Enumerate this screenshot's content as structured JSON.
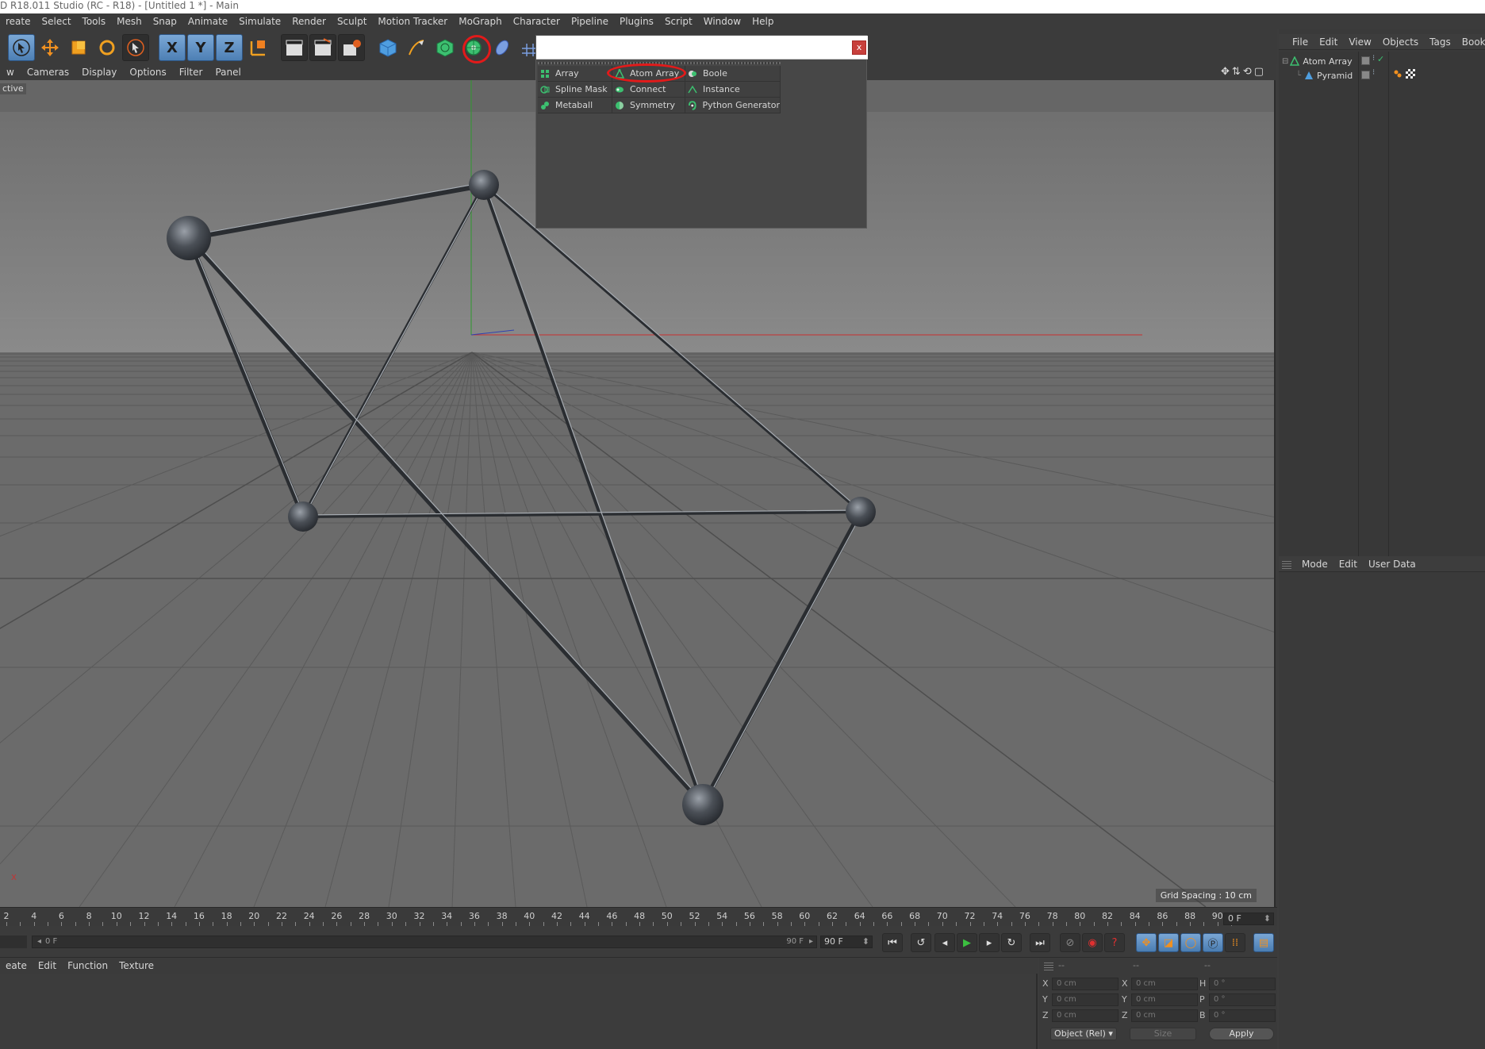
{
  "window": {
    "title": "D R18.011 Studio (RC - R18) - [Untitled 1 *] - Main"
  },
  "menubar": [
    "reate",
    "Select",
    "Tools",
    "Mesh",
    "Snap",
    "Animate",
    "Simulate",
    "Render",
    "Sculpt",
    "Motion Tracker",
    "MoGraph",
    "Character",
    "Pipeline",
    "Plugins",
    "Script",
    "Window",
    "Help"
  ],
  "toolbar": {
    "axis_x": "X",
    "axis_y": "Y",
    "axis_z": "Z"
  },
  "viewport": {
    "menu": [
      "w",
      "Cameras",
      "Display",
      "Options",
      "Filter",
      "Panel"
    ],
    "label": "ctive",
    "grid_spacing": "Grid Spacing : 10 cm",
    "axis_x_marker": "X",
    "colors": {
      "background": "#6a6a6a",
      "x_axis": "#c83030",
      "y_axis": "#2e9a2e"
    }
  },
  "popup": {
    "items": [
      [
        "Array",
        "Atom Array",
        "Boole"
      ],
      [
        "Spline Mask",
        "Connect",
        "Instance"
      ],
      [
        "Metaball",
        "Symmetry",
        "Python Generator"
      ]
    ],
    "close": "x",
    "highlighted": "Atom Array"
  },
  "objects_panel": {
    "menu": [
      "File",
      "Edit",
      "View",
      "Objects",
      "Tags",
      "Bookma"
    ],
    "items": [
      {
        "name": "Atom Array",
        "check": "✓"
      },
      {
        "name": "Pyramid"
      }
    ]
  },
  "attributes_panel": {
    "menu": [
      "Mode",
      "Edit",
      "User Data"
    ]
  },
  "timeline": {
    "ticks": [
      "2",
      "4",
      "6",
      "8",
      "10",
      "12",
      "14",
      "16",
      "18",
      "20",
      "22",
      "24",
      "26",
      "28",
      "30",
      "32",
      "34",
      "36",
      "38",
      "40",
      "42",
      "44",
      "46",
      "48",
      "50",
      "52",
      "54",
      "56",
      "58",
      "60",
      "62",
      "64",
      "66",
      "68",
      "70",
      "72",
      "74",
      "76",
      "78",
      "80",
      "82",
      "84",
      "86",
      "88",
      "90"
    ],
    "current_frame": "0 F",
    "slider_start": "0 F",
    "slider_end": "90 F",
    "end_frame": "90 F"
  },
  "material_bar": [
    "eate",
    "Edit",
    "Function",
    "Texture"
  ],
  "coordinates": {
    "headers": [
      "--",
      "--",
      "--"
    ],
    "labels_left": [
      "X",
      "Y",
      "Z"
    ],
    "labels_mid": [
      "X",
      "Y",
      "Z"
    ],
    "labels_right": [
      "H",
      "P",
      "B"
    ],
    "values_pos": [
      "0 cm",
      "0 cm",
      "0 cm"
    ],
    "values_size": [
      "0 cm",
      "0 cm",
      "0 cm"
    ],
    "values_rot": [
      "0 °",
      "0 °",
      "0 °"
    ],
    "mode_select": "Object (Rel) ▾",
    "size_select": "Size",
    "apply": "Apply"
  }
}
